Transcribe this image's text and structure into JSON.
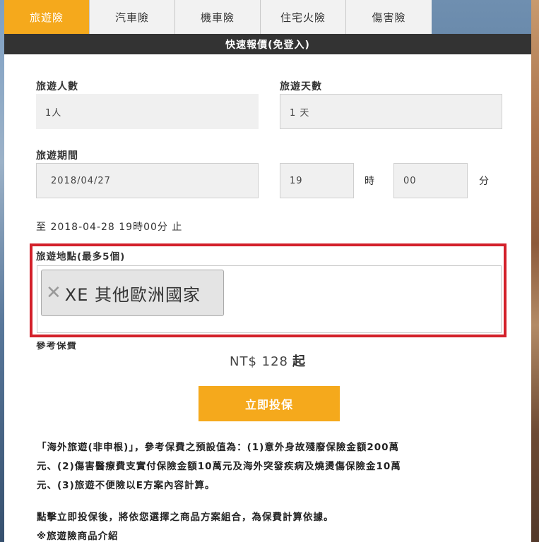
{
  "tabs": [
    {
      "label": "旅遊險",
      "active": true
    },
    {
      "label": "汽車險",
      "active": false
    },
    {
      "label": "機車險",
      "active": false
    },
    {
      "label": "住宅火險",
      "active": false
    },
    {
      "label": "傷害險",
      "active": false
    }
  ],
  "header": {
    "title": "快速報價(免登入)"
  },
  "form": {
    "travelers_label": "旅遊人數",
    "travelers_value": "1人",
    "days_label": "旅遊天數",
    "days_value": "1 天",
    "period_label": "旅遊期間",
    "start_date": "2018/04/27",
    "hour": "19",
    "hour_unit": "時",
    "minute": "00",
    "minute_unit": "分",
    "end_text": "至 2018-04-28 19時00分 止",
    "destination_label": "旅遊地點(最多5個)",
    "destination_tag": "XE 其他歐洲國家",
    "premium_label": "參考保費",
    "premium_value": "NT$ 128",
    "premium_suffix": "起",
    "submit_label": "立即投保"
  },
  "notes": {
    "line1": "「海外旅遊(非申根)」，參考保費之預設值為：(1)意外身故殘廢保險金額200萬",
    "line2": "元、(2)傷害醫療費支實付保險金額10萬元及海外突發疾病及燒燙傷保險金10萬",
    "line3": "元、(3)旅遊不便險以E方案內容計算。",
    "line4": "點擊立即投保後，將依您選擇之商品方案組合，為保費計算依據。",
    "line5": "※旅遊險商品介紹"
  },
  "colors": {
    "accent": "#f5a91c",
    "header_bg": "#333333",
    "highlight": "#d3202a"
  }
}
